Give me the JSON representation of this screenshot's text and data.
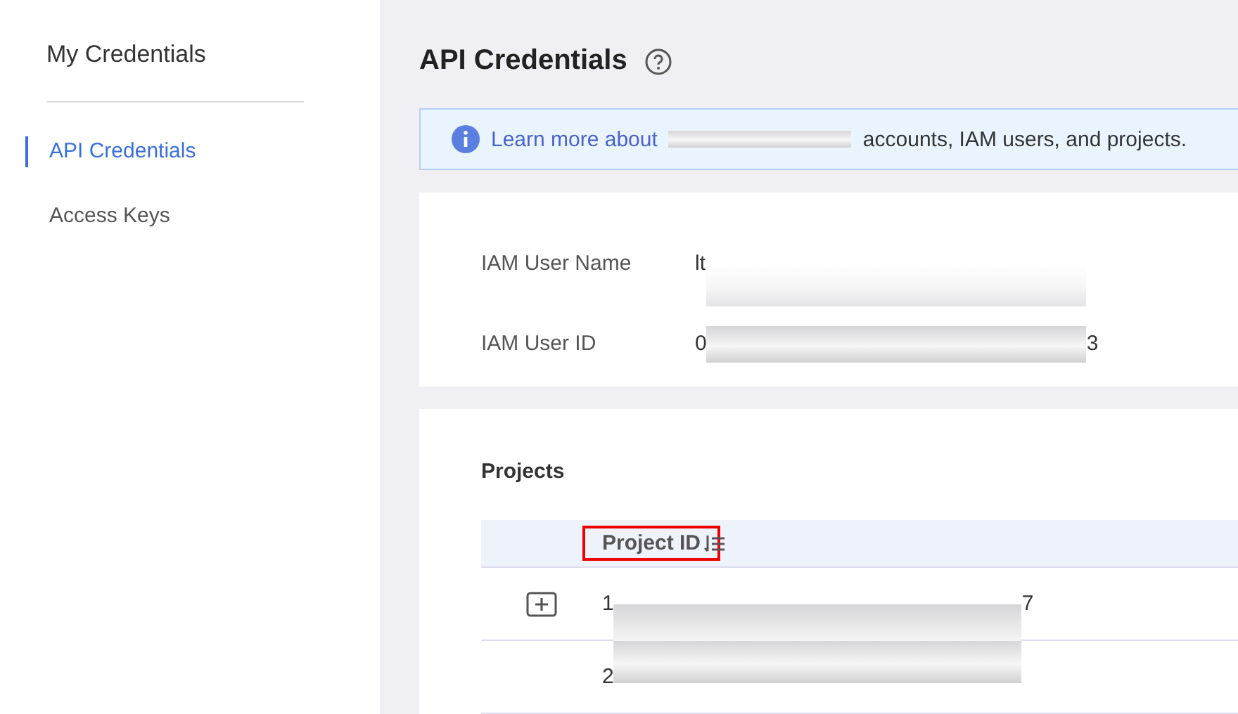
{
  "sidebar": {
    "title": "My Credentials",
    "items": [
      {
        "label": "API Credentials",
        "selected": true
      },
      {
        "label": "Access Keys",
        "selected": false
      }
    ]
  },
  "page": {
    "title": "API Credentials"
  },
  "banner": {
    "link": "Learn more about",
    "text": "accounts, IAM users, and projects."
  },
  "user_info": [
    {
      "label": "IAM User Name",
      "value_start": "lt"
    },
    {
      "label": "IAM User ID",
      "value_start": "0",
      "value_end": "3"
    }
  ],
  "projects": {
    "title": "Projects",
    "columns": [
      {
        "label": "Project ID",
        "highlighted": true
      }
    ],
    "rows": [
      {
        "expandable": true,
        "value_start": "1",
        "value_end": "7"
      },
      {
        "expandable": false,
        "value_start": "2"
      }
    ]
  }
}
